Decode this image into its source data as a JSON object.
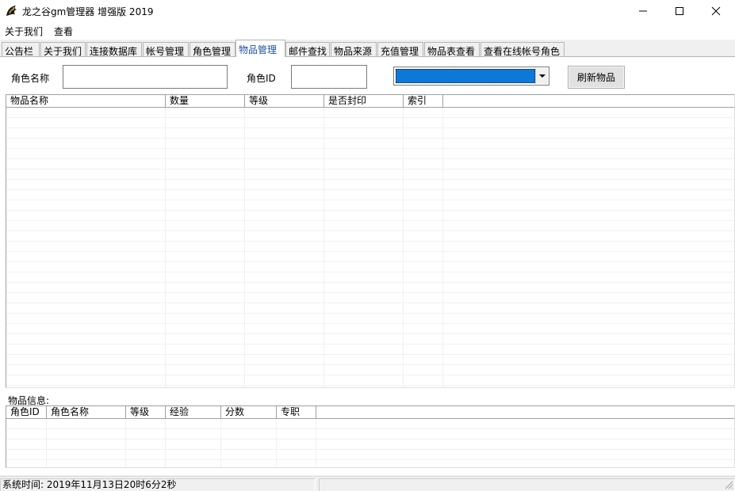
{
  "window": {
    "title": "龙之谷gm管理器 增强版  2019",
    "icon": "dragon-logo-icon",
    "controls": [
      "minimize-icon",
      "maximize-icon",
      "close-icon"
    ]
  },
  "menu": {
    "about": "关于我们",
    "view": "查看"
  },
  "tabs": [
    {
      "label": "公告栏"
    },
    {
      "label": "关于我们"
    },
    {
      "label": "连接数据库"
    },
    {
      "label": "帐号管理"
    },
    {
      "label": "角色管理"
    },
    {
      "label": "物品管理",
      "active": true
    },
    {
      "label": "邮件查找"
    },
    {
      "label": "物品来源"
    },
    {
      "label": "充值管理"
    },
    {
      "label": "物品表查看"
    },
    {
      "label": "查看在线帐号角色"
    }
  ],
  "form": {
    "role_name_label": "角色名称",
    "role_name_value": "",
    "role_id_label": "角色ID",
    "role_id_value": "",
    "combo_value": "",
    "refresh_button": "刷新物品"
  },
  "items_list": {
    "columns": [
      "物品名称",
      "数量",
      "等级",
      "是否封印",
      "索引"
    ],
    "rows": []
  },
  "item_info": {
    "label": "物品信息:",
    "columns": [
      "角色ID",
      "角色名称",
      "等级",
      "经验",
      "分数",
      "专职"
    ],
    "rows": []
  },
  "status": {
    "time_text": "系统时间: 2019年11月13日20时6分2秒",
    "right_text": ""
  },
  "colors": {
    "accent": "#0d78d8",
    "active_tab_text": "#1a4fa3"
  }
}
